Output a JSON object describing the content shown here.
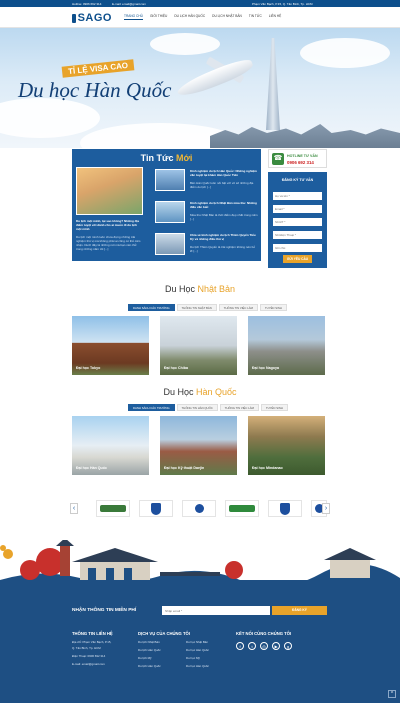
{
  "topbar": {
    "hotline": "Hotline: 0906 692 314",
    "email": "E-mail: email@gmail.com",
    "address": "Phạm Văn Bạch, P.15, Q. Tân Bình, Tp. HCM"
  },
  "nav": {
    "logo": "SAGO",
    "items": [
      "TRANG CHỦ",
      "GIỚI THIỆU",
      "DU LỊCH HÀN QUỐC",
      "DU LỊCH NHẬT BẢN",
      "TIN TỨC",
      "LIÊN HỆ"
    ]
  },
  "hero": {
    "badge": "TỈ LỆ VISA CAO",
    "title": "Du học Hàn Quốc"
  },
  "news": {
    "title_plain": "Tin Tức ",
    "title_highlight": "Mới",
    "featured_title": "Du lịch một mình, tại sao không? Những địa điểm tuyệt vời dành cho ai muốn đi du lịch một mình",
    "featured_excerpt": "Du lịch một mình luôn chưa đựng những trải nghiệm thú vị mà không phải ai cũng có thể cảm nhận. Dưới đây là những nơi mà bạn nên thử trong những năm tới [...]",
    "items": [
      {
        "title": "Kinh nghiệm du lịch Hàn Quốc: Những nghiệm cần tuyệt lại khám Hàn Quốc Tiên",
        "excerpt": "Bên Hàn Quốc luôn nổi bật với vô số những địa điểm du lịch [...]"
      },
      {
        "title": "Kinh nghiệm du lịch Nhật Bản mùa thu: Những điều cần biết",
        "excerpt": "Mùa thu Nhật Bản là thời điểm đẹp nhất trong năm [...]"
      },
      {
        "title": "Chia sẻ kinh nghiệm du lịch Thiên Quyển Tiểu Kỳ và những điều thú vị",
        "excerpt": "Du lịch Thiên Quyển là trải nghiệm không nên bỏ lỡ [...]"
      }
    ]
  },
  "hotline": {
    "label": "HOTLINE TƯ VẤN",
    "number": "0906 692 314"
  },
  "form": {
    "title": "ĐĂNG KÝ TƯ VẤN",
    "placeholders": [
      "Họ và tên *",
      "Email *",
      "Số ĐT *",
      "Số Điện Thoại *",
      "Ghi chú"
    ],
    "button": "GỬI YÊU CẦU"
  },
  "japan": {
    "title_plain": "Du Học ",
    "title_highlight": "Nhật Bản",
    "tabs": [
      "DANH SÁCH CÁC TRƯỜNG",
      "THÔNG TIN NHẬT BẢN",
      "THÔNG TIN VIỆC LÀM",
      "TUYỂN SINH"
    ],
    "cards": [
      "Đại học Tokyo",
      "Đại học Chiba",
      "Đại học Nagoya"
    ]
  },
  "korea": {
    "title_plain": "Du Học ",
    "title_highlight": "Hàn Quốc",
    "tabs": [
      "DANH SÁCH CÁC TRƯỜNG",
      "THÔNG TIN HÀN QUỐC",
      "THÔNG TIN VIỆC LÀM",
      "TUYỂN SINH"
    ],
    "cards": [
      "Đại học Hàn Quốc",
      "Đại học Kỹ thuật Daejin",
      "Đại học Mindanao"
    ]
  },
  "partners": {
    "logos": [
      "partner-1",
      "partner-2",
      "partner-3",
      "partner-4",
      "partner-5",
      "partner-6"
    ]
  },
  "footer": {
    "subscribe_title": "NHẬN THÔNG TIN MIỄN PHÍ",
    "subscribe_placeholder": "Nhập email *",
    "subscribe_button": "ĐĂNG KÝ",
    "contact_title": "THÔNG TIN LIÊN HỆ",
    "contact_lines": [
      "Địa chỉ: Phạm Văn Bạch, P.15,",
      "Q. Tân Bình, Tp. HCM",
      "Điện Thoại: 0906 692 314",
      "E-mail: email@gmail.com"
    ],
    "services_title": "DỊCH VỤ CỦA CHÚNG TÔI",
    "services_col1": [
      "Du lịch Nhật Bản",
      "Du lịch Hàn Quốc",
      "Du lịch Mỹ",
      "Du lịch Hàn Quốc"
    ],
    "services_col2": [
      "Du học Nhật Bản",
      "Du học Hàn Quốc",
      "Du học Mỹ",
      "Du học Hàn Quốc"
    ],
    "social_title": "KẾT NỐI CÙNG CHÚNG TÔI"
  },
  "colors": {
    "primary": "#1d5d9e",
    "dark_blue": "#0d4f8c",
    "accent": "#e8a32a",
    "footer": "#1e4f83"
  }
}
